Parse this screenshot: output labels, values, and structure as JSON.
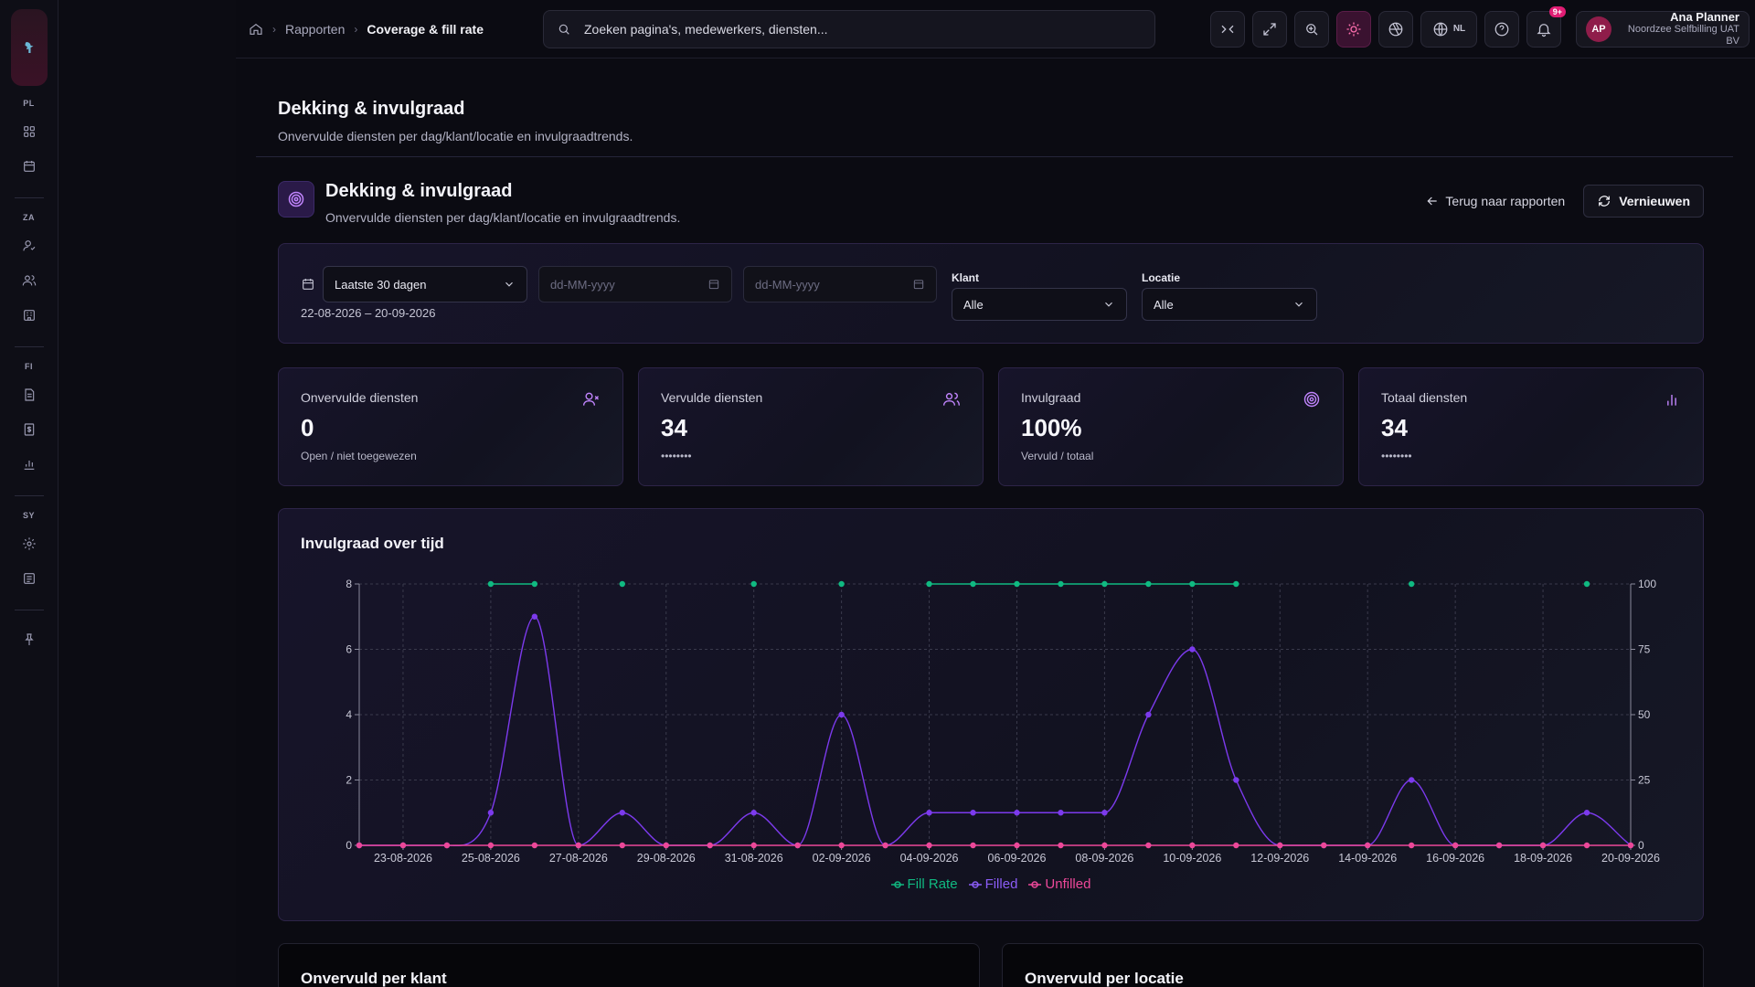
{
  "sidebar": {
    "groups": [
      {
        "label": "PL",
        "items": [
          "dashboard-icon",
          "calendar-icon"
        ]
      },
      {
        "label": "ZA",
        "items": [
          "user-check-icon",
          "users-icon",
          "building-icon"
        ]
      },
      {
        "label": "FI",
        "items": [
          "document-icon",
          "invoice-icon",
          "bar-chart-icon"
        ]
      },
      {
        "label": "SY",
        "items": [
          "gear-icon",
          "logs-icon"
        ]
      }
    ]
  },
  "breadcrumb": {
    "parent": "Rapporten",
    "current": "Coverage & fill rate"
  },
  "search": {
    "placeholder": "Zoeken pagina's, medewerkers, diensten..."
  },
  "topbar": {
    "language": "NL",
    "notifications_badge": "9+"
  },
  "user": {
    "initials": "AP",
    "name": "Ana Planner",
    "org": "Noordzee Selfbilling UAT BV"
  },
  "page": {
    "title": "Dekking & invulgraad",
    "subtitle": "Onvervulde diensten per dag/klant/locatie en invulgraadtrends."
  },
  "section": {
    "title": "Dekking & invulgraad",
    "subtitle": "Onvervulde diensten per dag/klant/locatie en invulgraadtrends.",
    "back_label": "Terug naar rapporten",
    "refresh_label": "Vernieuwen"
  },
  "filters": {
    "period": "Laatste 30 dagen",
    "date_from_placeholder": "dd-MM-yyyy",
    "date_to_placeholder": "dd-MM-yyyy",
    "range": "22-08-2026 – 20-09-2026",
    "client_label": "Klant",
    "client_value": "Alle",
    "location_label": "Locatie",
    "location_value": "Alle"
  },
  "kpis": [
    {
      "title": "Onvervulde diensten",
      "value": "0",
      "sub": "Open / niet toegewezen",
      "icon": "user-x-icon"
    },
    {
      "title": "Vervulde diensten",
      "value": "34",
      "sub": "••••••••",
      "icon": "users-icon"
    },
    {
      "title": "Invulgraad",
      "value": "100%",
      "sub": "Vervuld / totaal",
      "icon": "target-icon"
    },
    {
      "title": "Totaal diensten",
      "value": "34",
      "sub": "••••••••",
      "icon": "bar-chart-icon"
    }
  ],
  "chart_title": "Invulgraad over tijd",
  "chart_data": {
    "type": "line",
    "x": [
      "22-08-2026",
      "23-08-2026",
      "24-08-2026",
      "25-08-2026",
      "26-08-2026",
      "27-08-2026",
      "28-08-2026",
      "29-08-2026",
      "30-08-2026",
      "31-08-2026",
      "01-09-2026",
      "02-09-2026",
      "03-09-2026",
      "04-09-2026",
      "05-09-2026",
      "06-09-2026",
      "07-09-2026",
      "08-09-2026",
      "09-09-2026",
      "10-09-2026",
      "11-09-2026",
      "12-09-2026",
      "13-09-2026",
      "14-09-2026",
      "15-09-2026",
      "16-09-2026",
      "17-09-2026",
      "18-09-2026",
      "19-09-2026",
      "20-09-2026"
    ],
    "x_tick_labels": [
      "23-08-2026",
      "25-08-2026",
      "27-08-2026",
      "29-08-2026",
      "31-08-2026",
      "02-09-2026",
      "04-09-2026",
      "06-09-2026",
      "08-09-2026",
      "10-09-2026",
      "12-09-2026",
      "14-09-2026",
      "16-09-2026",
      "18-09-2026",
      "20-09-2026"
    ],
    "y_left_ticks": [
      0,
      2,
      4,
      6,
      8
    ],
    "y_right_ticks": [
      0,
      25,
      50,
      75,
      100
    ],
    "ylim_left": [
      0,
      8
    ],
    "ylim_right": [
      0,
      100
    ],
    "series": [
      {
        "name": "Fill Rate",
        "axis": "right",
        "color": "#10b981",
        "values": [
          null,
          null,
          null,
          100,
          100,
          null,
          100,
          null,
          null,
          100,
          null,
          100,
          null,
          100,
          100,
          100,
          100,
          100,
          100,
          100,
          100,
          null,
          null,
          null,
          100,
          null,
          null,
          null,
          100,
          null
        ]
      },
      {
        "name": "Filled",
        "axis": "left",
        "color": "#7c3aed",
        "values": [
          0,
          0,
          0,
          1,
          7,
          0,
          1,
          0,
          0,
          1,
          0,
          4,
          0,
          1,
          1,
          1,
          1,
          1,
          4,
          6,
          2,
          0,
          0,
          0,
          2,
          0,
          0,
          0,
          1,
          0
        ]
      },
      {
        "name": "Unfilled",
        "axis": "left",
        "color": "#ec4899",
        "values": [
          0,
          0,
          0,
          0,
          0,
          0,
          0,
          0,
          0,
          0,
          0,
          0,
          0,
          0,
          0,
          0,
          0,
          0,
          0,
          0,
          0,
          0,
          0,
          0,
          0,
          0,
          0,
          0,
          0,
          0
        ]
      }
    ],
    "grid": true,
    "legend": "bottom-center"
  },
  "bottom": {
    "left_title": "Onvervuld per klant",
    "right_title": "Onvervuld per locatie"
  }
}
